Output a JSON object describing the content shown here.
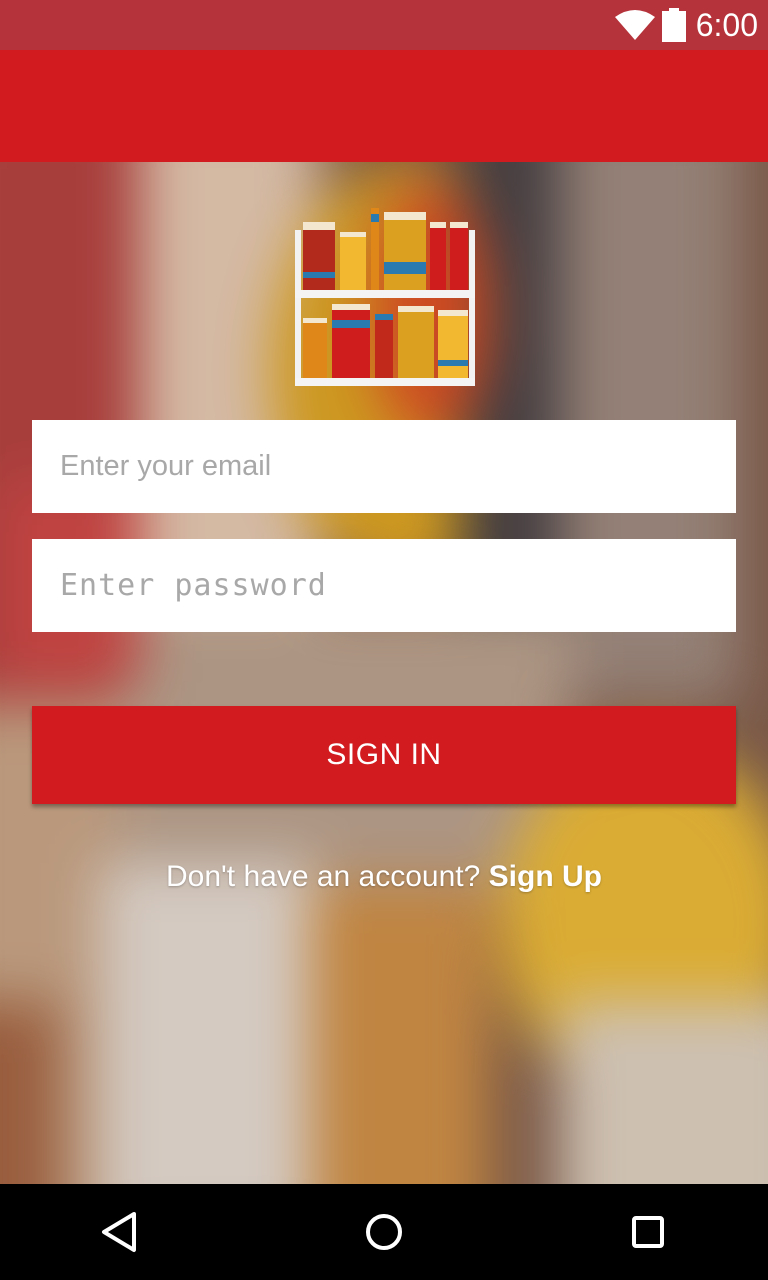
{
  "status_bar": {
    "time": "6:00",
    "icons": [
      "wifi-icon",
      "battery-icon"
    ]
  },
  "app_bar": {
    "color": "#d11b1f"
  },
  "logo": {
    "icon": "bookshelf-logo-icon"
  },
  "login_form": {
    "email_placeholder": "Enter your email",
    "email_value": "",
    "password_placeholder": "Enter password",
    "password_value": "",
    "sign_in_label": "SIGN IN",
    "signup_prompt": "Don't have an account?",
    "signup_link": "Sign Up"
  },
  "nav_bar": {
    "icons": [
      "back-icon",
      "home-icon",
      "recents-icon"
    ]
  },
  "colors": {
    "accent": "#d11b1f",
    "status_bar": "#b5333a",
    "nav_bar": "#000000",
    "field_bg": "#ffffff",
    "placeholder": "#a8a8a8"
  }
}
